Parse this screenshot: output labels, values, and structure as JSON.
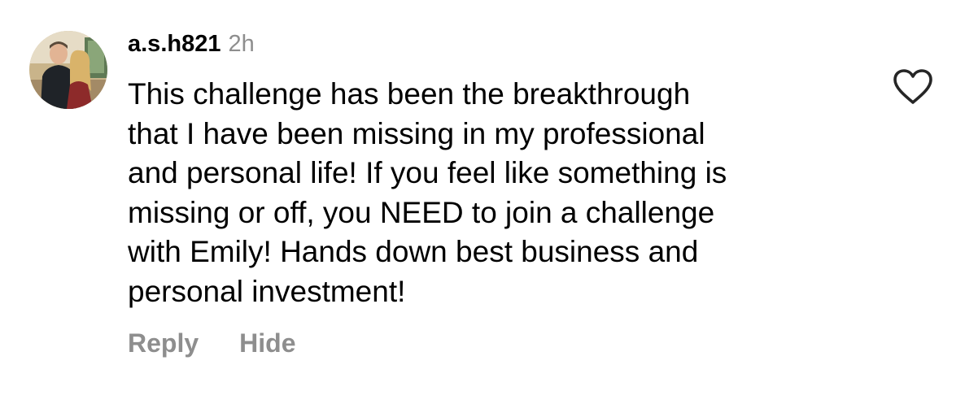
{
  "comment": {
    "avatar_icon": "user-avatar-photo",
    "username": "a.s.h821",
    "timestamp": "2h",
    "text": "This challenge has been the breakthrough\nthat I have been missing in my professional\nand personal life! If you feel like something is\nmissing or off, you NEED to join a challenge\nwith Emily! Hands down best business and\npersonal  investment!",
    "actions": {
      "reply_label": "Reply",
      "hide_label": "Hide"
    },
    "like_icon": "heart-outline-icon"
  },
  "colors": {
    "text": "#000000",
    "secondary_text": "#8e8e8e",
    "background": "#ffffff"
  }
}
